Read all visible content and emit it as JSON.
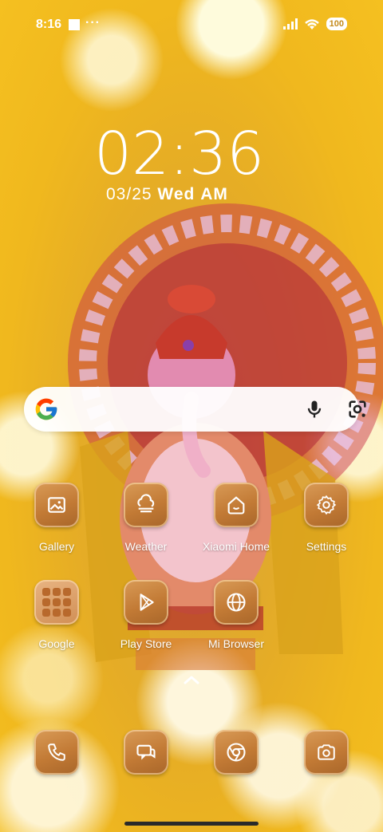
{
  "status_bar": {
    "time": "8:16",
    "dots": "···",
    "battery": "100"
  },
  "clock": {
    "time": "02:36",
    "date": "03/25",
    "weekday": "Wed",
    "ampm": "AM"
  },
  "apps_row1": [
    {
      "label": "Gallery",
      "icon": "gallery-icon"
    },
    {
      "label": "Weather",
      "icon": "weather-icon"
    },
    {
      "label": "Xiaomi Home",
      "icon": "xiaomi-home-icon"
    },
    {
      "label": "Settings",
      "icon": "settings-icon"
    }
  ],
  "apps_row2": [
    {
      "label": "Google",
      "icon": "google-folder-icon"
    },
    {
      "label": "Play Store",
      "icon": "play-store-icon"
    },
    {
      "label": "Mi Browser",
      "icon": "mi-browser-icon"
    }
  ],
  "dock": [
    {
      "icon": "phone-icon"
    },
    {
      "icon": "messages-icon"
    },
    {
      "icon": "chrome-icon"
    },
    {
      "icon": "camera-icon"
    }
  ],
  "colors": {
    "tile": "#c27a35",
    "background": "#f0b81e"
  }
}
